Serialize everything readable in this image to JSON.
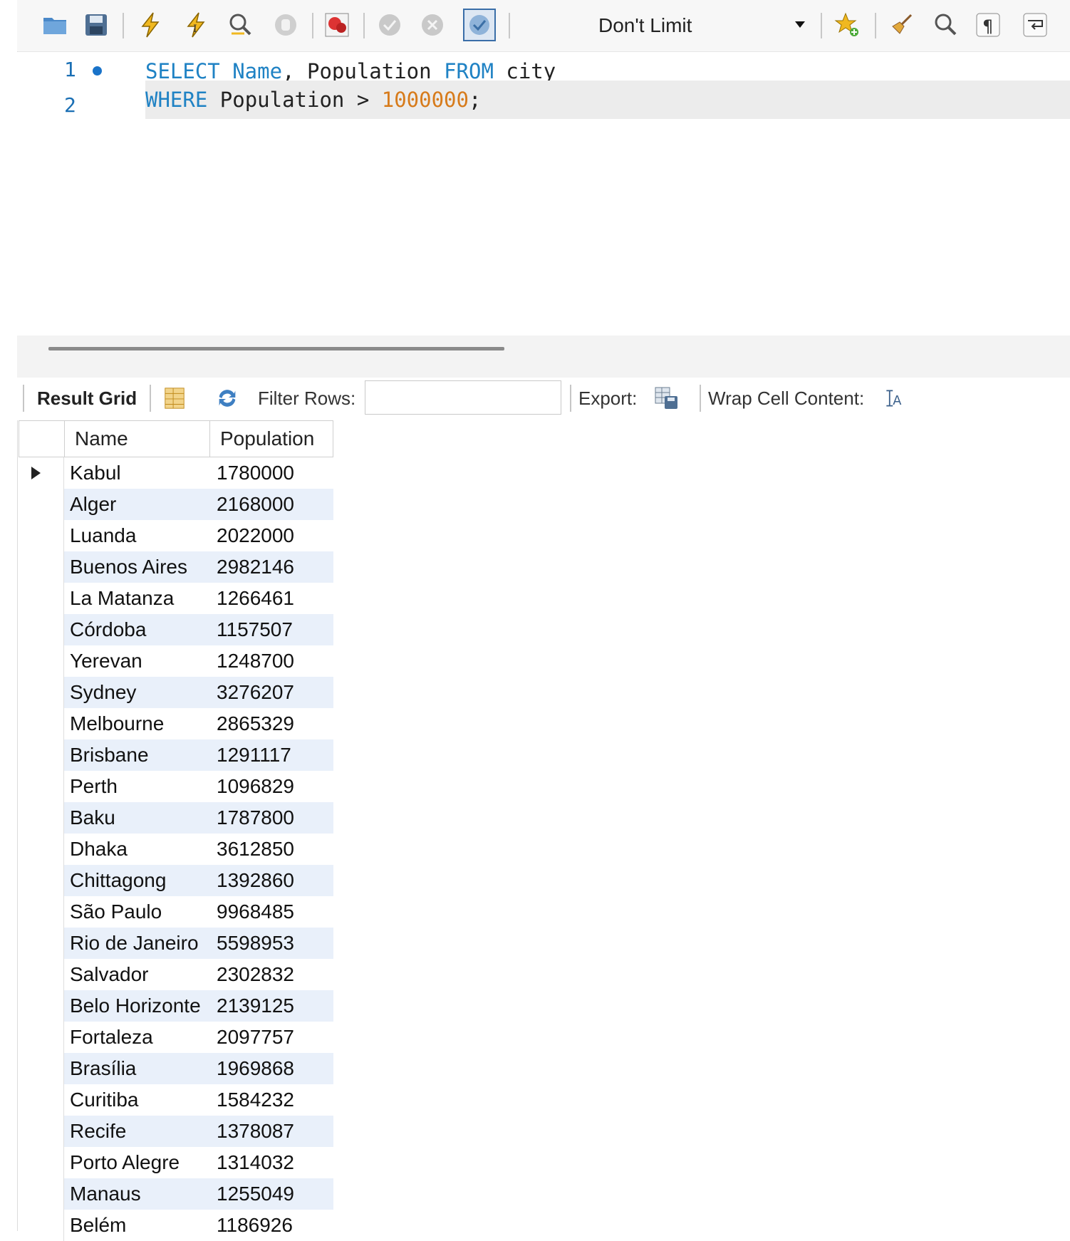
{
  "toolbar": {
    "limit_select": "Don't Limit",
    "icons": [
      "open-folder-icon",
      "save-icon",
      "execute-icon",
      "execute-statement-icon",
      "explain-icon",
      "stop-icon",
      "toggle-stop-on-error-icon",
      "commit-icon",
      "rollback-icon",
      "autocommit-icon",
      "bookmark-star-icon",
      "beautify-broom-icon",
      "find-icon",
      "invisible-chars-icon",
      "word-wrap-icon"
    ]
  },
  "editor": {
    "lines": [
      {
        "number": "1",
        "t1": "SELECT",
        "t2": " Name",
        "t3": ", Population ",
        "t4": "FROM",
        "t5": " city"
      },
      {
        "number": "2",
        "t1": "WHERE",
        "t2": " Population > ",
        "t3": "1000000",
        "t4": ";"
      }
    ]
  },
  "result_toolbar": {
    "result_grid": "Result Grid",
    "filter_rows": "Filter Rows:",
    "filter_value": "",
    "export": "Export:",
    "wrap_cell": "Wrap Cell Content:"
  },
  "grid": {
    "columns": [
      "Name",
      "Population"
    ],
    "rows": [
      [
        "Kabul",
        "1780000"
      ],
      [
        "Alger",
        "2168000"
      ],
      [
        "Luanda",
        "2022000"
      ],
      [
        "Buenos Aires",
        "2982146"
      ],
      [
        "La Matanza",
        "1266461"
      ],
      [
        "Córdoba",
        "1157507"
      ],
      [
        "Yerevan",
        "1248700"
      ],
      [
        "Sydney",
        "3276207"
      ],
      [
        "Melbourne",
        "2865329"
      ],
      [
        "Brisbane",
        "1291117"
      ],
      [
        "Perth",
        "1096829"
      ],
      [
        "Baku",
        "1787800"
      ],
      [
        "Dhaka",
        "3612850"
      ],
      [
        "Chittagong",
        "1392860"
      ],
      [
        "São Paulo",
        "9968485"
      ],
      [
        "Rio de Janeiro",
        "5598953"
      ],
      [
        "Salvador",
        "2302832"
      ],
      [
        "Belo Horizonte",
        "2139125"
      ],
      [
        "Fortaleza",
        "2097757"
      ],
      [
        "Brasília",
        "1969868"
      ],
      [
        "Curitiba",
        "1584232"
      ],
      [
        "Recife",
        "1378087"
      ],
      [
        "Porto Alegre",
        "1314032"
      ],
      [
        "Manaus",
        "1255049"
      ],
      [
        "Belém",
        "1186926"
      ]
    ]
  },
  "colors": {
    "keyword": "#1f82c4",
    "number": "#d77b1b",
    "row_alt": "#e9f0fa"
  }
}
